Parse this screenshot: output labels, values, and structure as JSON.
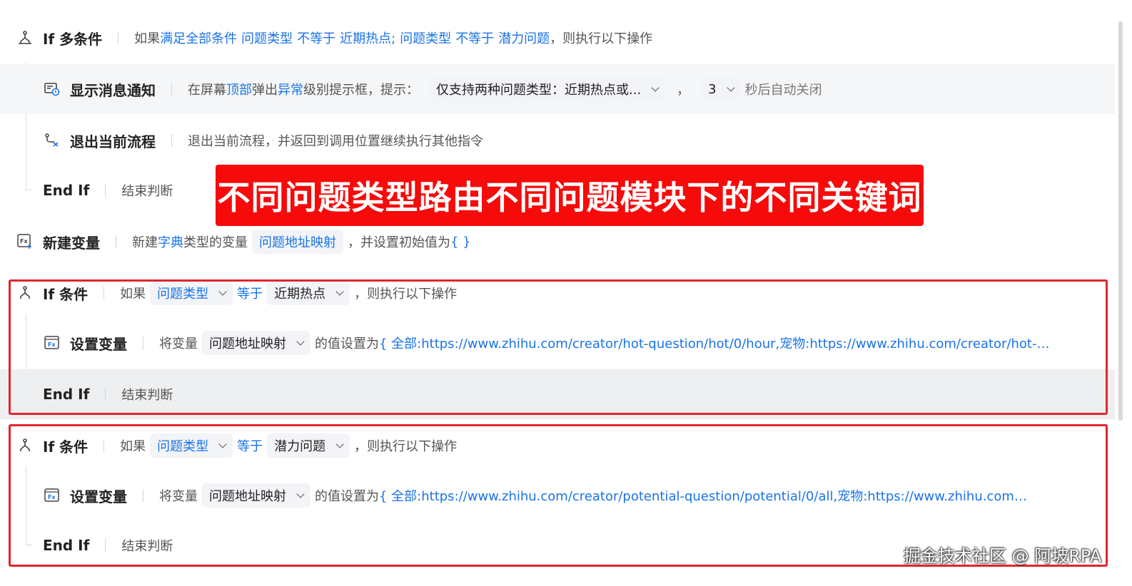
{
  "rows": {
    "if_multi": {
      "title": "If 多条件",
      "prefix": "如果",
      "cond_all": "满足全部条件",
      "c1_var": "问题类型",
      "c1_op": "不等于",
      "c1_val": "近期热点;",
      "c2_var": "问题类型",
      "c2_op": "不等于",
      "c2_val": "潜力问题",
      "suffix": "，则执行以下操作"
    },
    "notify": {
      "title": "显示消息通知",
      "t1": "在屏幕",
      "pos": "顶部",
      "t2": "弹出",
      "level": "异常",
      "t3": "级别提示框，提示：",
      "message": "仅支持两种问题类型：近期热点或...",
      "comma": "，",
      "seconds": "3",
      "t4": "秒后自动关闭"
    },
    "exit": {
      "title": "退出当前流程",
      "desc": "退出当前流程，并返回到调用位置继续执行其他指令"
    },
    "endif1": {
      "title": "End If",
      "desc": "结束判断"
    },
    "newvar": {
      "title": "新建变量",
      "t1": "新建",
      "type": "字典",
      "t2": "类型的变量",
      "var_name": "问题地址映射",
      "t3": "，并设置初始值为",
      "init": "{ }"
    },
    "if1": {
      "title": "If 条件",
      "prefix": "如果",
      "var": "问题类型",
      "op": "等于",
      "val": "近期热点",
      "suffix": "，则执行以下操作"
    },
    "setvar1": {
      "title": "设置变量",
      "t1": "将变量",
      "var": "问题地址映射",
      "t2": "的值设置为",
      "value": "{ 全部:https://www.zhihu.com/creator/hot-question/hot/0/hour,宠物:https://www.zhihu.com/creator/hot-ques..."
    },
    "endif2": {
      "title": "End If",
      "desc": "结束判断"
    },
    "if2": {
      "title": "If 条件",
      "prefix": "如果",
      "var": "问题类型",
      "op": "等于",
      "val": "潜力问题",
      "suffix": "，则执行以下操作"
    },
    "setvar2": {
      "title": "设置变量",
      "t1": "将变量",
      "var": "问题地址映射",
      "t2": "的值设置为",
      "value": "{ 全部:https://www.zhihu.com/creator/potential-question/potential/0/all,宠物:https://www.zhihu.com/creat..."
    },
    "endif3": {
      "title": "End If",
      "desc": "结束判断"
    }
  },
  "banner": "不同问题类型路由不同问题模块下的不同关键词",
  "watermark": "掘金技术社区 @ 阿坡RPA",
  "colors": {
    "accent": "#1a73e8",
    "banner": "#f70a0a",
    "highlight_box": "#e0262c"
  },
  "icons": {
    "branch": "branch-icon",
    "notify": "message-notification-icon",
    "exit": "exit-flow-icon",
    "variable": "fx-variable-icon",
    "chevron": "chevron-down-icon"
  }
}
